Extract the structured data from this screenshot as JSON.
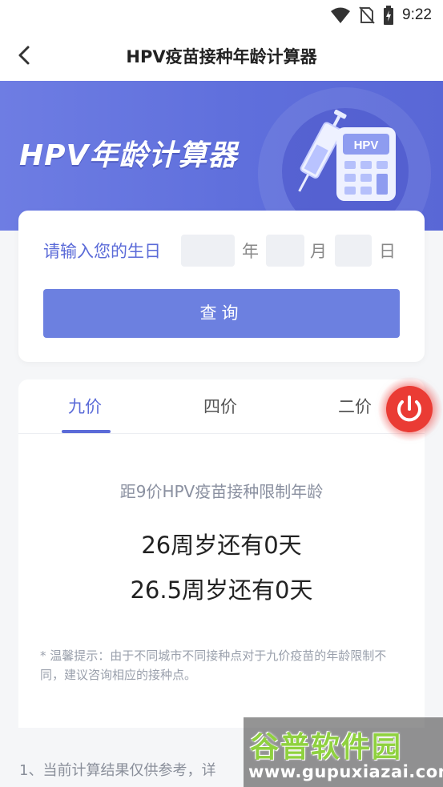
{
  "status_bar": {
    "time": "9:22"
  },
  "nav": {
    "title": "HPV疫苗接种年龄计算器"
  },
  "banner": {
    "title": "HPV年龄计算器",
    "badge": "HPV"
  },
  "birth_form": {
    "label": "请输入您的生日",
    "year_unit": "年",
    "month_unit": "月",
    "day_unit": "日",
    "year_value": "",
    "month_value": "",
    "day_value": "",
    "query_button": "查询"
  },
  "tabs": [
    {
      "label": "九价",
      "active": true
    },
    {
      "label": "四价",
      "active": false
    },
    {
      "label": "二价",
      "active": false
    }
  ],
  "result": {
    "subtitle": "距9价HPV疫苗接种限制年龄",
    "line1": "26周岁还有0天",
    "line2": "26.5周岁还有0天",
    "tip": "* 温馨提示：由于不同城市不同接种点对于九价疫苗的年龄限制不同，建议咨询相应的接种点。"
  },
  "footnote": "1、当前计算结果仅供参考，详",
  "watermark": {
    "title": "谷普软件园",
    "url": "www.gupuxiazai.com"
  },
  "colors": {
    "accent": "#5b6bd8",
    "button": "#6c80e0",
    "power": "#ea3b34"
  }
}
